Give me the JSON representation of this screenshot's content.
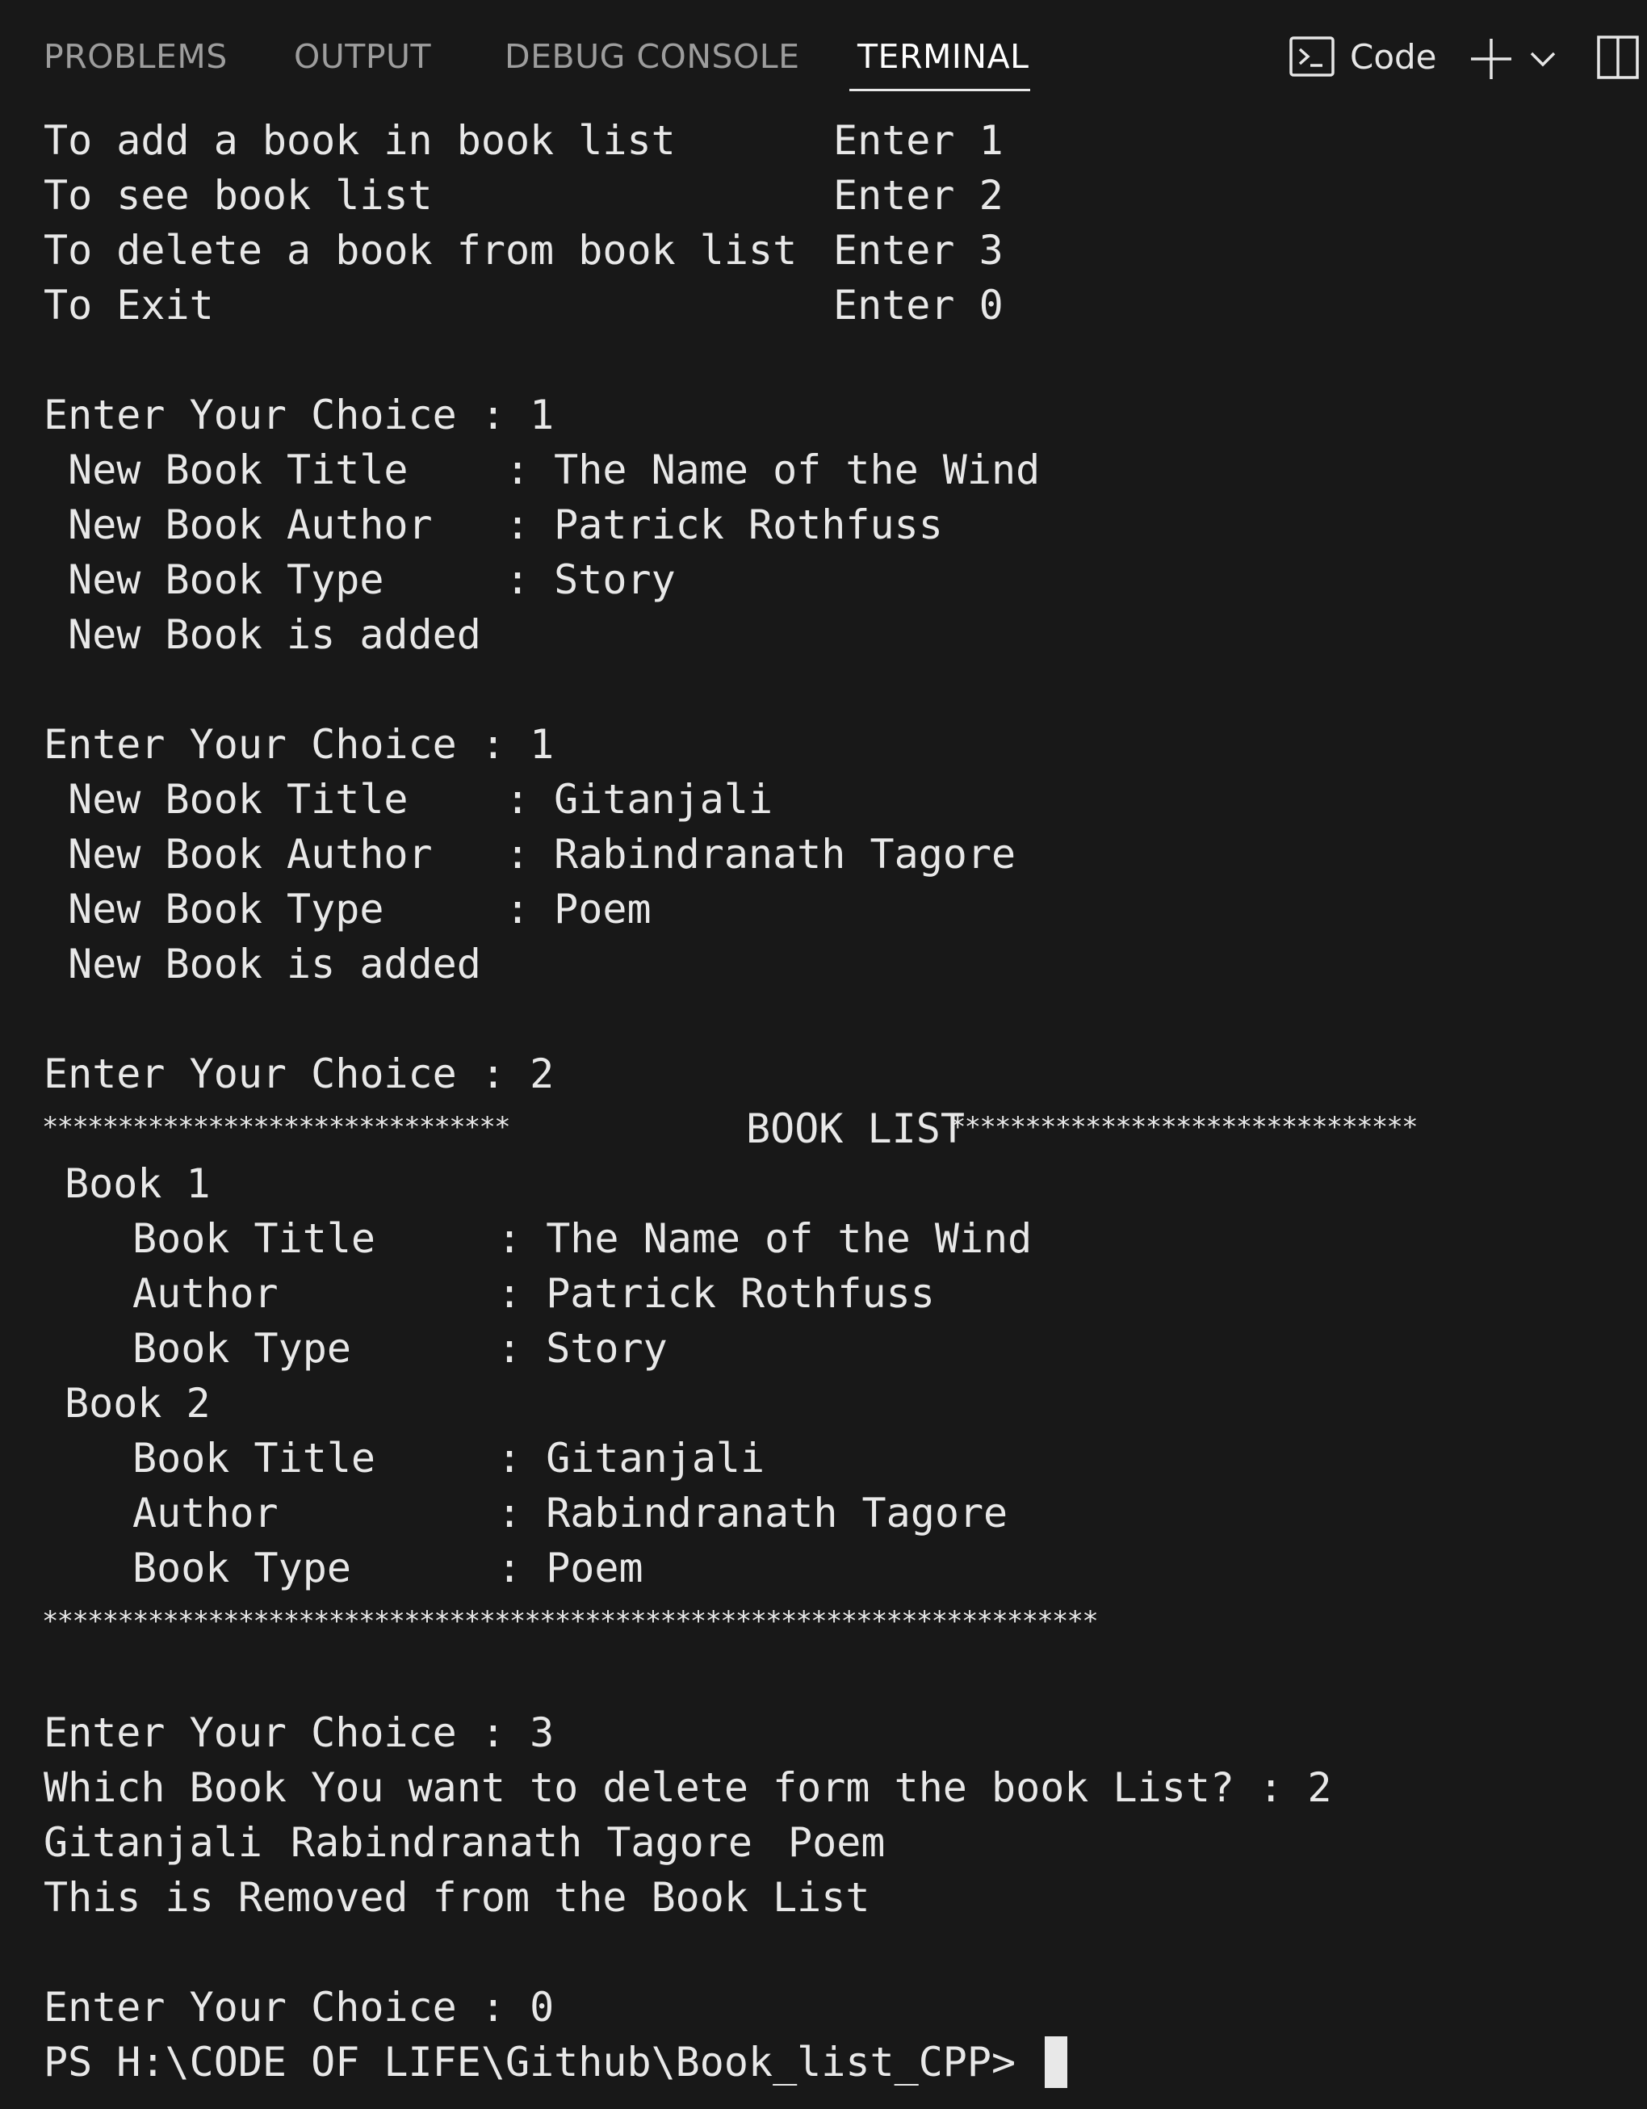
{
  "panel": {
    "tabs": [
      {
        "label": "PROBLEMS",
        "active": false
      },
      {
        "label": "OUTPUT",
        "active": false
      },
      {
        "label": "DEBUG CONSOLE",
        "active": false
      },
      {
        "label": "TERMINAL",
        "active": true
      }
    ],
    "shell_label": "Code",
    "icons": [
      "terminal-icon",
      "plus-icon",
      "chevron-down-icon",
      "split-panel-icon"
    ]
  },
  "terminal": {
    "menu": [
      {
        "text": "To add a book in book list",
        "option": "Enter 1"
      },
      {
        "text": "To see book list",
        "option": "Enter 2"
      },
      {
        "text": "To delete a book from book list",
        "option": "Enter 3"
      },
      {
        "text": "To Exit",
        "option": "Enter 0"
      }
    ],
    "choice_prompt": "Enter Your Choice : ",
    "session1": {
      "choice": "1",
      "title_label": " New Book Title    : ",
      "title": "The Name of the Wind",
      "author_label": " New Book Author   : ",
      "author": "Patrick Rothfuss",
      "type_label": " New Book Type     : ",
      "type": "Story",
      "added": " New Book is added"
    },
    "session2": {
      "choice": "1",
      "title_label": " New Book Title    : ",
      "title": "Gitanjali",
      "author_label": " New Book Author   : ",
      "author": "Rabindranath Tagore",
      "type_label": " New Book Type     : ",
      "type": "Poem",
      "added": " New Book is added"
    },
    "session3": {
      "choice": "2",
      "stars_left": "*******************************",
      "banner": "BOOK LIST",
      "stars_right": "*******************************",
      "stars_full": "**********************************************************************",
      "book1_header": "Book 1",
      "book1": {
        "title_label": "Book Title",
        "title": ": The Name of the Wind",
        "author_label": "Author",
        "author": ": Patrick Rothfuss",
        "type_label": "Book Type",
        "type": ": Story"
      },
      "book2_header": "Book 2",
      "book2": {
        "title_label": "Book Title",
        "title": ": Gitanjali",
        "author_label": "Author",
        "author": ": Rabindranath Tagore",
        "type_label": "Book Type",
        "type": ": Poem"
      }
    },
    "session4": {
      "choice": "3",
      "question": "Which Book You want to delete form the book List? : 2",
      "removed_title": "Gitanjali",
      "removed_author": "Rabindranath Tagore",
      "removed_type": "Poem",
      "removed_msg": "This is Removed from the Book List"
    },
    "session5": {
      "choice": "0"
    },
    "ps_prompt": "PS H:\\CODE OF LIFE\\Github\\Book_list_CPP> "
  },
  "colors": {
    "background": "#181818",
    "text": "#e8e8e8",
    "inactive_tab": "#9d9d9d"
  }
}
